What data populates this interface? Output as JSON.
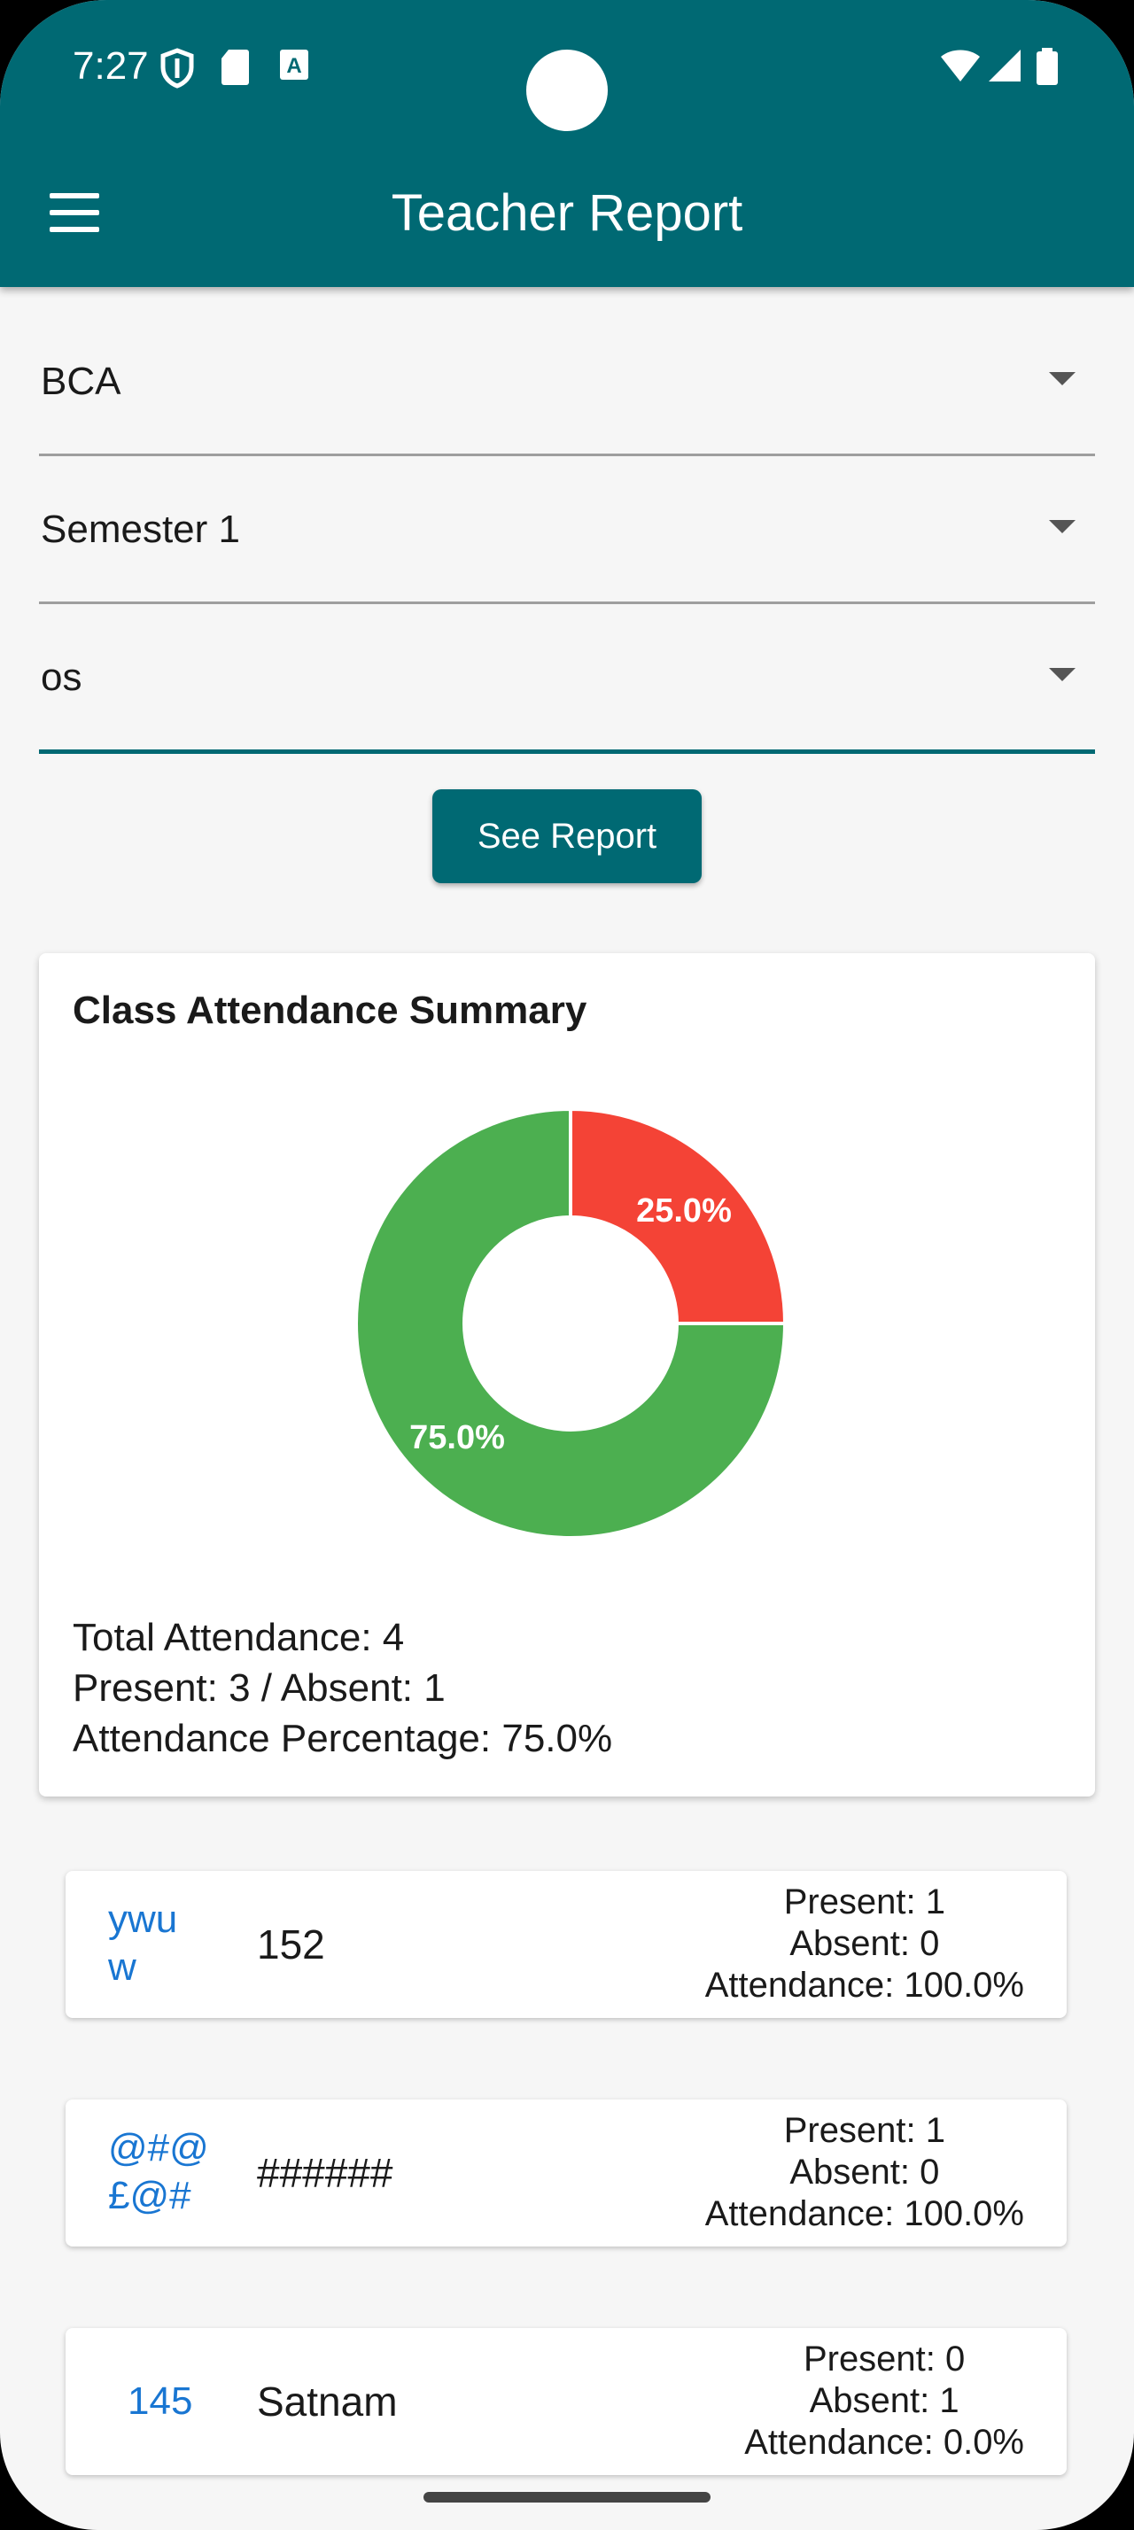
{
  "status_bar": {
    "time": "7:27"
  },
  "appbar": {
    "title": "Teacher Report"
  },
  "colors": {
    "primary": "#006973",
    "present": "#4caf50",
    "absent": "#f44336",
    "link": "#1976d2"
  },
  "filters": {
    "course": "BCA",
    "semester": "Semester 1",
    "subject": "os"
  },
  "see_report_label": "See Report",
  "summary": {
    "title": "Class Attendance Summary",
    "total_line": "Total Attendance: 4",
    "present_absent_line": "Present: 3 / Absent: 1",
    "percentage_line": "Attendance Percentage: 75.0%"
  },
  "chart_data": {
    "type": "pie",
    "donut": true,
    "slices": [
      {
        "label": "25.0%",
        "value": 25.0,
        "color": "#f44336"
      },
      {
        "label": "75.0%",
        "value": 75.0,
        "color": "#4caf50"
      }
    ]
  },
  "students": [
    {
      "roll": "ywu\nw",
      "name": "152",
      "present": "Present: 1",
      "absent": "Absent: 0",
      "attendance": "Attendance: 100.0%"
    },
    {
      "roll": "@#@\n£@#",
      "name": "######",
      "present": "Present: 1",
      "absent": "Absent: 0",
      "attendance": "Attendance: 100.0%"
    },
    {
      "roll": "145",
      "name": "Satnam",
      "present": "Present: 0",
      "absent": "Absent: 1",
      "attendance": "Attendance: 0.0%"
    }
  ]
}
